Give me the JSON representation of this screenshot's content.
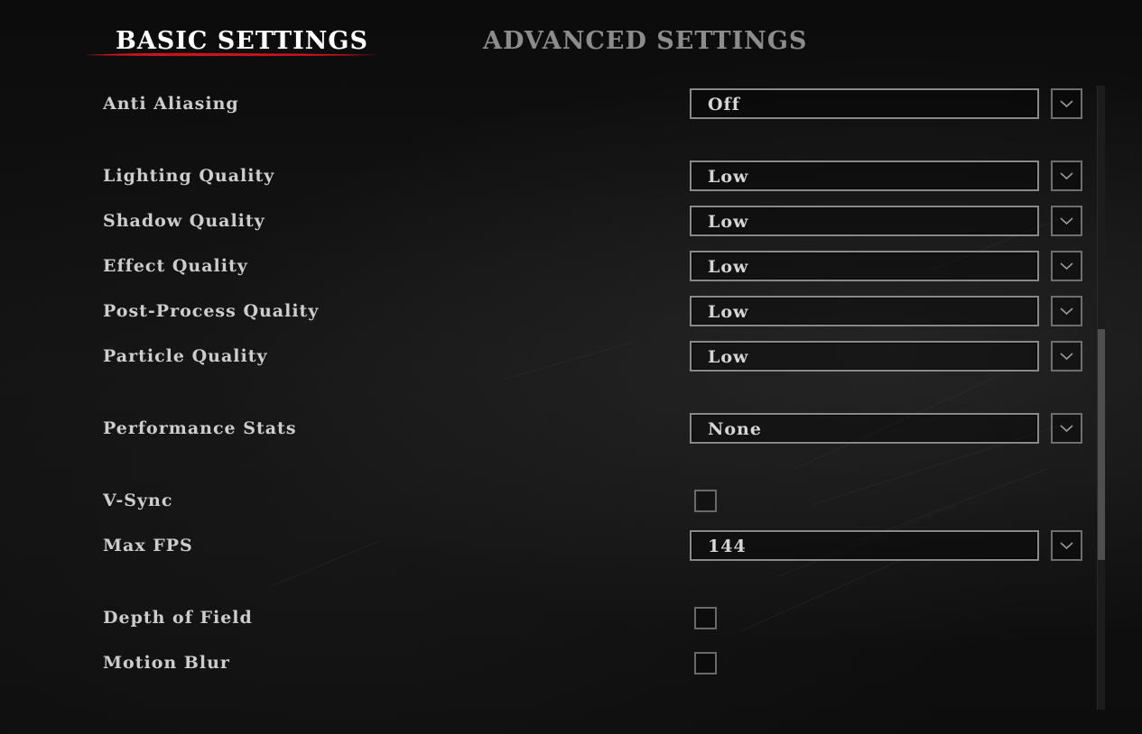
{
  "tabs": {
    "basic": "BASIC SETTINGS",
    "advanced": "ADVANCED SETTINGS",
    "active": "basic"
  },
  "colors": {
    "accent_underline": "#c8141e",
    "active_tab_text": "#ffffff",
    "inactive_tab_text": "#8c8c8c"
  },
  "settings": {
    "anti_aliasing": {
      "label": "Anti Aliasing",
      "value": "Off"
    },
    "lighting_quality": {
      "label": "Lighting Quality",
      "value": "Low"
    },
    "shadow_quality": {
      "label": "Shadow Quality",
      "value": "Low"
    },
    "effect_quality": {
      "label": "Effect Quality",
      "value": "Low"
    },
    "post_process_quality": {
      "label": "Post-Process Quality",
      "value": "Low"
    },
    "particle_quality": {
      "label": "Particle Quality",
      "value": "Low"
    },
    "performance_stats": {
      "label": "Performance Stats",
      "value": "None"
    },
    "v_sync": {
      "label": "V-Sync",
      "checked": false
    },
    "max_fps": {
      "label": "Max FPS",
      "value": "144"
    },
    "depth_of_field": {
      "label": "Depth of Field",
      "checked": false
    },
    "motion_blur": {
      "label": "Motion Blur",
      "checked": false
    }
  },
  "icons": {
    "dropdown": "chevron-down-icon"
  },
  "scrollbar": {
    "thumb_start_fraction": 0.39,
    "thumb_end_fraction": 0.76
  }
}
